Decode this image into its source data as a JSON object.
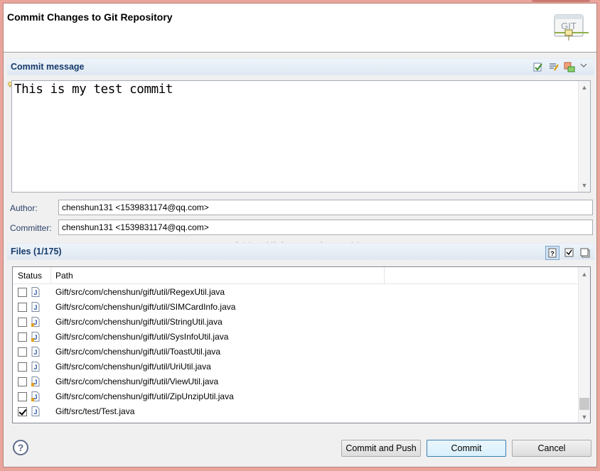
{
  "dialog": {
    "title": "Commit Changes to Git Repository",
    "logo_text": "GIT"
  },
  "commit_message": {
    "section_title": "Commit message",
    "text": "This is my test commit"
  },
  "author": {
    "label": "Author:",
    "value": "chenshun131 <1539831174@qq.com>"
  },
  "committer": {
    "label": "Committer:",
    "value": "chenshun131 <1539831174@qq.com>"
  },
  "files": {
    "section_title": "Files (1/175)",
    "columns": [
      "Status",
      "Path"
    ],
    "rows": [
      {
        "path": "Gift/src/com/chenshun/gift/util/RegexUtil.java",
        "checked": false,
        "modified": false
      },
      {
        "path": "Gift/src/com/chenshun/gift/util/SIMCardInfo.java",
        "checked": false,
        "modified": false
      },
      {
        "path": "Gift/src/com/chenshun/gift/util/StringUtil.java",
        "checked": false,
        "modified": true
      },
      {
        "path": "Gift/src/com/chenshun/gift/util/SysInfoUtil.java",
        "checked": false,
        "modified": true
      },
      {
        "path": "Gift/src/com/chenshun/gift/util/ToastUtil.java",
        "checked": false,
        "modified": false
      },
      {
        "path": "Gift/src/com/chenshun/gift/util/UriUtil.java",
        "checked": false,
        "modified": false
      },
      {
        "path": "Gift/src/com/chenshun/gift/util/ViewUtil.java",
        "checked": false,
        "modified": true
      },
      {
        "path": "Gift/src/com/chenshun/gift/util/ZipUnzipUtil.java",
        "checked": false,
        "modified": true
      },
      {
        "path": "Gift/src/test/Test.java",
        "checked": true,
        "modified": false
      }
    ]
  },
  "watermark": "http://blog.csdn.net/",
  "buttons": {
    "help": "?",
    "commit_and_push": "Commit and Push",
    "commit": "Commit",
    "cancel": "Cancel"
  },
  "colors": {
    "window_border": "#e9a49b",
    "section_title": "#163a6a",
    "default_button": "#3c7fb1"
  }
}
